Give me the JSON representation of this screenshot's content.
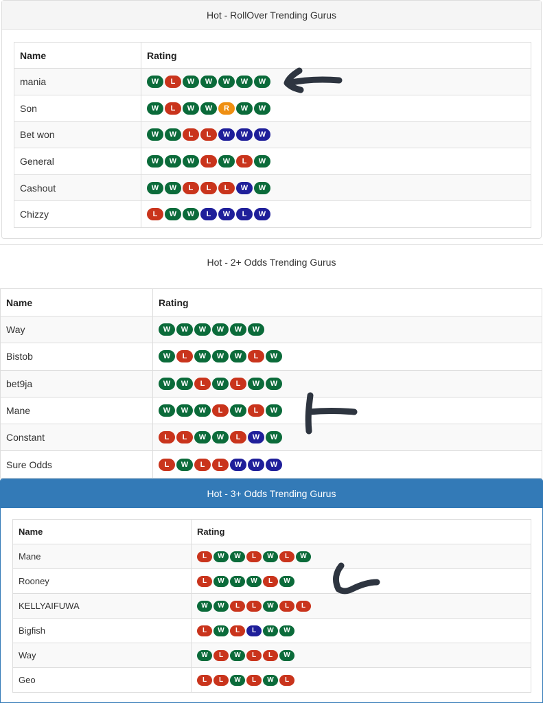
{
  "colors": {
    "win": "#0b6b3a",
    "loss": "#c9341c",
    "rollover": "#ef8f12",
    "blue": "#1f1f9a",
    "primary_header": "#337ab7"
  },
  "panel1": {
    "title": "Hot - RollOver Trending Gurus",
    "headers": [
      "Name",
      "Rating"
    ],
    "rows": [
      {
        "name": "mania",
        "rating": [
          "W",
          "L",
          "W",
          "W",
          "W",
          "W",
          "W"
        ],
        "blue": [
          0,
          0,
          0,
          0,
          0,
          0,
          0
        ]
      },
      {
        "name": "Son",
        "rating": [
          "W",
          "L",
          "W",
          "W",
          "R",
          "W",
          "W"
        ],
        "blue": [
          0,
          0,
          0,
          0,
          0,
          0,
          0
        ]
      },
      {
        "name": "Bet won",
        "rating": [
          "W",
          "W",
          "L",
          "L",
          "W",
          "W",
          "W"
        ],
        "blue": [
          0,
          0,
          0,
          0,
          1,
          1,
          1
        ]
      },
      {
        "name": "General",
        "rating": [
          "W",
          "W",
          "W",
          "L",
          "W",
          "L",
          "W"
        ],
        "blue": [
          0,
          0,
          0,
          0,
          0,
          0,
          0
        ]
      },
      {
        "name": "Cashout",
        "rating": [
          "W",
          "W",
          "L",
          "L",
          "L",
          "W",
          "W"
        ],
        "blue": [
          0,
          0,
          0,
          0,
          0,
          1,
          0
        ]
      },
      {
        "name": "Chizzy",
        "rating": [
          "L",
          "W",
          "W",
          "L",
          "W",
          "L",
          "W"
        ],
        "blue": [
          0,
          0,
          0,
          1,
          1,
          1,
          1
        ]
      }
    ]
  },
  "panel2": {
    "title": "Hot - 2+ Odds Trending Gurus",
    "headers": [
      "Name",
      "Rating"
    ],
    "rows": [
      {
        "name": "Way",
        "rating": [
          "W",
          "W",
          "W",
          "W",
          "W",
          "W"
        ],
        "blue": [
          0,
          0,
          0,
          0,
          0,
          0
        ]
      },
      {
        "name": "Bistob",
        "rating": [
          "W",
          "L",
          "W",
          "W",
          "W",
          "L",
          "W"
        ],
        "blue": [
          0,
          0,
          0,
          0,
          0,
          0,
          0
        ]
      },
      {
        "name": "bet9ja",
        "rating": [
          "W",
          "W",
          "L",
          "W",
          "L",
          "W",
          "W"
        ],
        "blue": [
          0,
          0,
          0,
          0,
          0,
          0,
          0
        ]
      },
      {
        "name": "Mane",
        "rating": [
          "W",
          "W",
          "W",
          "L",
          "W",
          "L",
          "W"
        ],
        "blue": [
          0,
          0,
          0,
          0,
          0,
          0,
          0
        ]
      },
      {
        "name": "Constant",
        "rating": [
          "L",
          "L",
          "W",
          "W",
          "L",
          "W",
          "W"
        ],
        "blue": [
          0,
          0,
          0,
          0,
          0,
          1,
          0
        ]
      },
      {
        "name": "Sure Odds",
        "rating": [
          "L",
          "W",
          "L",
          "L",
          "W",
          "W",
          "W"
        ],
        "blue": [
          0,
          0,
          0,
          0,
          1,
          1,
          1
        ]
      }
    ]
  },
  "panel3": {
    "title": "Hot - 3+ Odds Trending Gurus",
    "headers": [
      "Name",
      "Rating"
    ],
    "rows": [
      {
        "name": "Mane",
        "rating": [
          "L",
          "W",
          "W",
          "L",
          "W",
          "L",
          "W"
        ],
        "blue": [
          0,
          0,
          0,
          0,
          0,
          0,
          0
        ]
      },
      {
        "name": "Rooney",
        "rating": [
          "L",
          "W",
          "W",
          "W",
          "L",
          "W"
        ],
        "blue": [
          0,
          0,
          0,
          0,
          0,
          0
        ]
      },
      {
        "name": "KELLYAIFUWA",
        "rating": [
          "W",
          "W",
          "L",
          "L",
          "W",
          "L",
          "L"
        ],
        "blue": [
          0,
          0,
          0,
          0,
          0,
          0,
          0
        ]
      },
      {
        "name": "Bigfish",
        "rating": [
          "L",
          "W",
          "L",
          "L",
          "W",
          "W"
        ],
        "blue": [
          0,
          0,
          0,
          1,
          0,
          0
        ]
      },
      {
        "name": "Way",
        "rating": [
          "W",
          "L",
          "W",
          "L",
          "L",
          "W"
        ],
        "blue": [
          0,
          0,
          0,
          0,
          0,
          0
        ]
      },
      {
        "name": "Geo",
        "rating": [
          "L",
          "L",
          "W",
          "L",
          "W",
          "L"
        ],
        "blue": [
          0,
          0,
          0,
          0,
          0,
          0
        ]
      }
    ]
  }
}
